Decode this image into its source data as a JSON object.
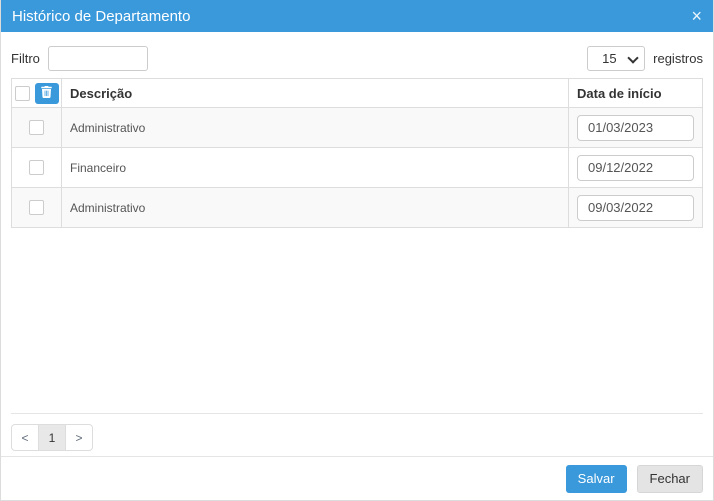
{
  "dialog": {
    "title": "Histórico de Departamento",
    "close_icon": "×"
  },
  "toolbar": {
    "filter_label": "Filtro",
    "filter_value": "",
    "page_size_selected": "15",
    "page_size_suffix": "registros"
  },
  "table": {
    "columns": {
      "description": "Descrição",
      "start_date": "Data de início"
    },
    "rows": [
      {
        "description": "Administrativo",
        "start_date": "01/03/2023",
        "checked": false
      },
      {
        "description": "Financeiro",
        "start_date": "09/12/2022",
        "checked": false
      },
      {
        "description": "Administrativo",
        "start_date": "09/03/2022",
        "checked": false
      }
    ]
  },
  "pagination": {
    "prev_label": "<",
    "current_page": "1",
    "next_label": ">"
  },
  "footer": {
    "save_label": "Salvar",
    "close_label": "Fechar"
  },
  "colors": {
    "accent": "#3a99db",
    "striped_row": "#f9f9f9",
    "border": "#dddddd"
  }
}
